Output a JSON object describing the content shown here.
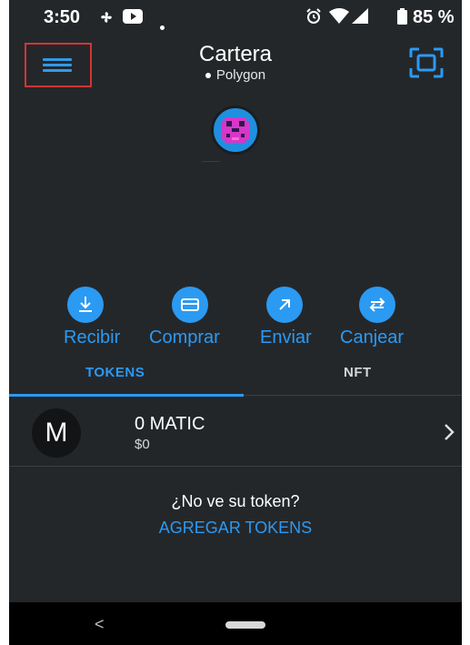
{
  "status_bar": {
    "time": "3:50",
    "battery": "85 %",
    "icons": [
      "fan-icon",
      "youtube-icon",
      "dot-icon",
      "alarm-icon",
      "wifi-icon",
      "signal-icon",
      "battery-icon"
    ]
  },
  "header": {
    "title": "Cartera",
    "network": "Polygon",
    "menu_icon": "hamburger-menu-icon",
    "scan_icon": "qr-scan-icon"
  },
  "actions": [
    {
      "label": "Recibir",
      "icon": "download-icon"
    },
    {
      "label": "Comprar",
      "icon": "card-icon"
    },
    {
      "label": "Enviar",
      "icon": "arrow-up-right-icon"
    },
    {
      "label": "Canjear",
      "icon": "swap-icon"
    }
  ],
  "tabs": [
    {
      "label": "TOKENS",
      "active": true
    },
    {
      "label": "NFT",
      "active": false
    }
  ],
  "token": {
    "symbol_letter": "M",
    "amount": "0 MATIC",
    "value": "$0"
  },
  "footer": {
    "missing_text": "¿No ve su token?",
    "add_link": "AGREGAR TOKENS"
  },
  "nav_bar": {
    "back": "<"
  },
  "colors": {
    "background": "#24272a",
    "accent": "#2b9af3",
    "highlight_box": "#d03535"
  }
}
